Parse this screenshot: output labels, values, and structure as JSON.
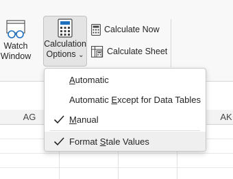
{
  "ribbon": {
    "watch_window": {
      "line1": "Watch",
      "line2": "Window",
      "icon": "glasses-window-icon"
    },
    "calculation_options": {
      "line1": "Calculation",
      "line2": "Options",
      "chevron": "⌄",
      "icon": "calculator-icon"
    },
    "calculate_now": {
      "label": "Calculate Now",
      "icon": "calculator-small-icon"
    },
    "calculate_sheet": {
      "label": "Calculate Sheet",
      "icon": "calculate-sheet-icon"
    }
  },
  "columns": [
    "AG",
    "AK"
  ],
  "menu": {
    "items": [
      {
        "pre": "",
        "accel": "A",
        "post": "utomatic",
        "checked": false
      },
      {
        "pre": "Automatic ",
        "accel": "E",
        "post": "xcept for Data Tables",
        "checked": false
      },
      {
        "pre": "",
        "accel": "M",
        "post": "anual",
        "checked": true
      },
      {
        "pre": "Format ",
        "accel": "S",
        "post": "tale Values",
        "checked": true
      }
    ]
  }
}
